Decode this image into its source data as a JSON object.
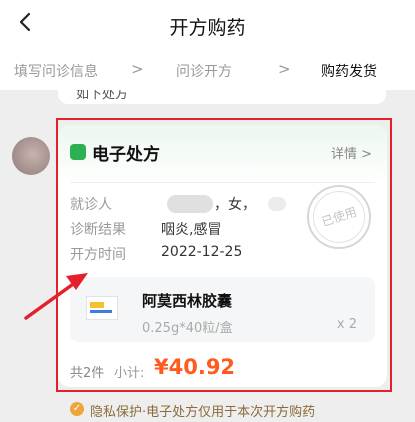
{
  "header": {
    "title": "开方购药"
  },
  "steps": [
    {
      "label": "填写问诊信息"
    },
    {
      "label": "问诊开方"
    },
    {
      "label": "购药发货"
    }
  ],
  "previous_card": {
    "partial_text": "如下处方"
  },
  "prescription": {
    "title": "电子处方",
    "detail_link": "详情",
    "patient_label": "就诊人",
    "patient_value": "，女，",
    "diagnosis_label": "诊断结果",
    "diagnosis_value": "咽炎,感冒",
    "date_label": "开方时间",
    "date_value": "2022-12-25",
    "stamp": "已使用",
    "drug": {
      "name": "阿莫西林胶囊",
      "spec": "0.25g*40粒/盒",
      "quantity": "x 2"
    },
    "count": "共2件",
    "subtotal_label": "小计:",
    "price": "¥40.92"
  },
  "notice": {
    "text": "隐私保护·电子处方仅用于本次开方购药"
  },
  "colors": {
    "accent": "#ff5a1f",
    "brand_green": "#2db052",
    "highlight": "#e4202a"
  }
}
